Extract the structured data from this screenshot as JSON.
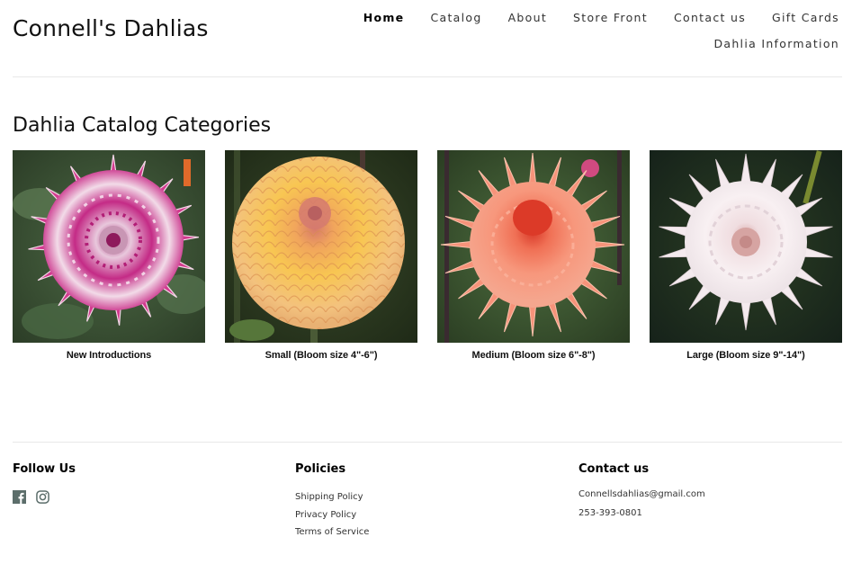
{
  "header": {
    "site_title": "Connell's Dahlias",
    "nav": [
      {
        "label": "Home",
        "active": true
      },
      {
        "label": "Catalog",
        "active": false
      },
      {
        "label": "About",
        "active": false
      },
      {
        "label": "Store Front",
        "active": false
      },
      {
        "label": "Contact us",
        "active": false
      },
      {
        "label": "Gift Cards",
        "active": false
      },
      {
        "label": "Dahlia Information",
        "active": false
      }
    ]
  },
  "main": {
    "section_title": "Dahlia Catalog Categories",
    "categories": [
      {
        "label": "New Introductions",
        "image": "pink-white-dahlia"
      },
      {
        "label": "Small (Bloom size 4\"-6\")",
        "image": "peach-yellow-ball-dahlia"
      },
      {
        "label": "Medium (Bloom size 6\"-8\")",
        "image": "coral-cactus-dahlia"
      },
      {
        "label": "Large (Bloom size 9\"-14\")",
        "image": "white-blush-dahlia"
      }
    ]
  },
  "footer": {
    "follow_us": {
      "heading": "Follow Us",
      "icons": [
        "facebook-icon",
        "instagram-icon"
      ],
      "icon_color": "#5c6e6b"
    },
    "policies": {
      "heading": "Policies",
      "links": [
        "Shipping Policy",
        "Privacy Policy",
        "Terms of Service"
      ]
    },
    "contact": {
      "heading": "Contact us",
      "email": "Connellsdahlias@gmail.com",
      "phone": "253-393-0801"
    }
  }
}
